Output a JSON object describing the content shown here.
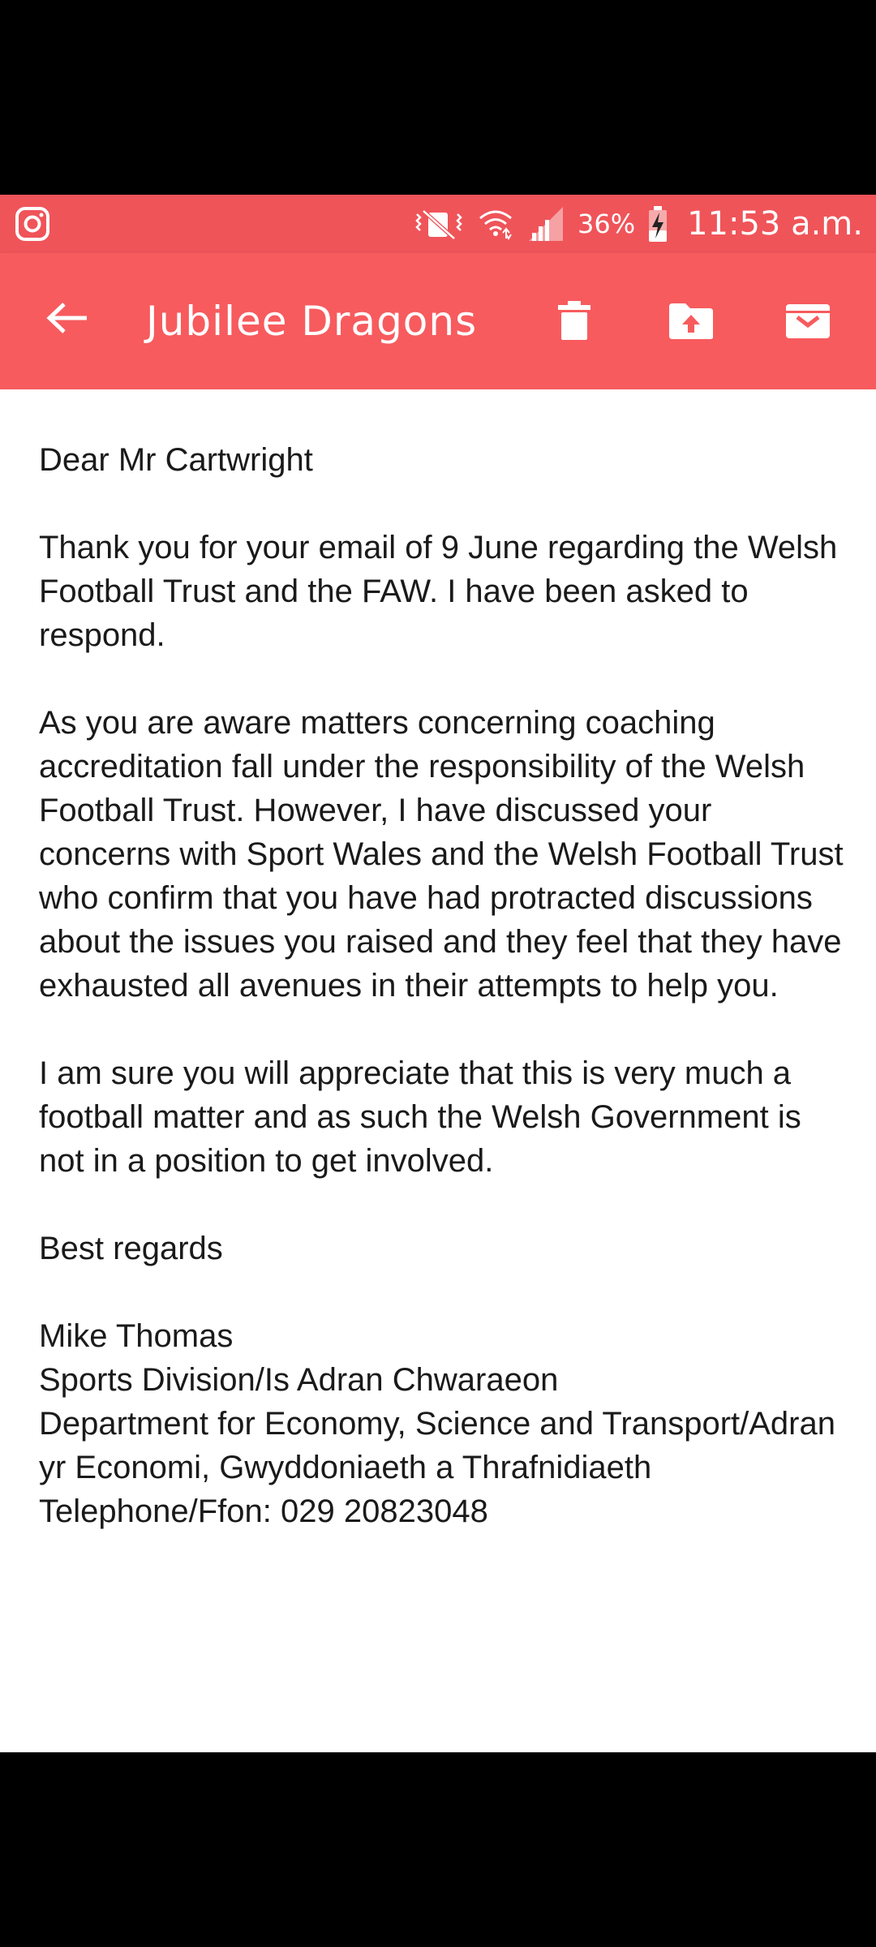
{
  "status_bar": {
    "battery_percent": "36%",
    "time": "11:53 a.m.",
    "icons": [
      "instagram-icon",
      "vibrate-silent-icon",
      "wifi-icon",
      "signal-icon",
      "battery-charging-icon"
    ]
  },
  "app_bar": {
    "title": "Jubilee Dragons",
    "icons": [
      "back-arrow-icon",
      "delete-icon",
      "move-to-folder-icon",
      "archive-icon"
    ]
  },
  "email": {
    "greeting": "Dear Mr Cartwright",
    "paragraphs": [
      "Thank you for your email of 9 June regarding the Welsh Football Trust and the FAW.  I have been asked to respond.",
      "As you are aware matters concerning coaching accreditation fall under the responsibility of the Welsh Football Trust.  However, I have discussed your concerns with Sport Wales and the Welsh Football Trust who confirm that you have had protracted discussions about the issues you raised and  they feel that they have exhausted all avenues in their  attempts to help you.",
      "I am sure you will appreciate that this is very much a football matter and as such the Welsh Government is not in a position to get involved."
    ],
    "closing": "Best regards",
    "signature": {
      "name": "Mike Thomas",
      "division": "Sports Division/Is Adran Chwaraeon",
      "department": "Department for Economy, Science and Transport/Adran yr Economi, Gwyddoniaeth a Thrafnidiaeth",
      "telephone": "Telephone/Ffon:  029 20823048"
    }
  },
  "colors": {
    "status_bar": "#ef5459",
    "app_bar": "#f75b5e",
    "text": "#1a1a1a",
    "background": "#ffffff"
  }
}
